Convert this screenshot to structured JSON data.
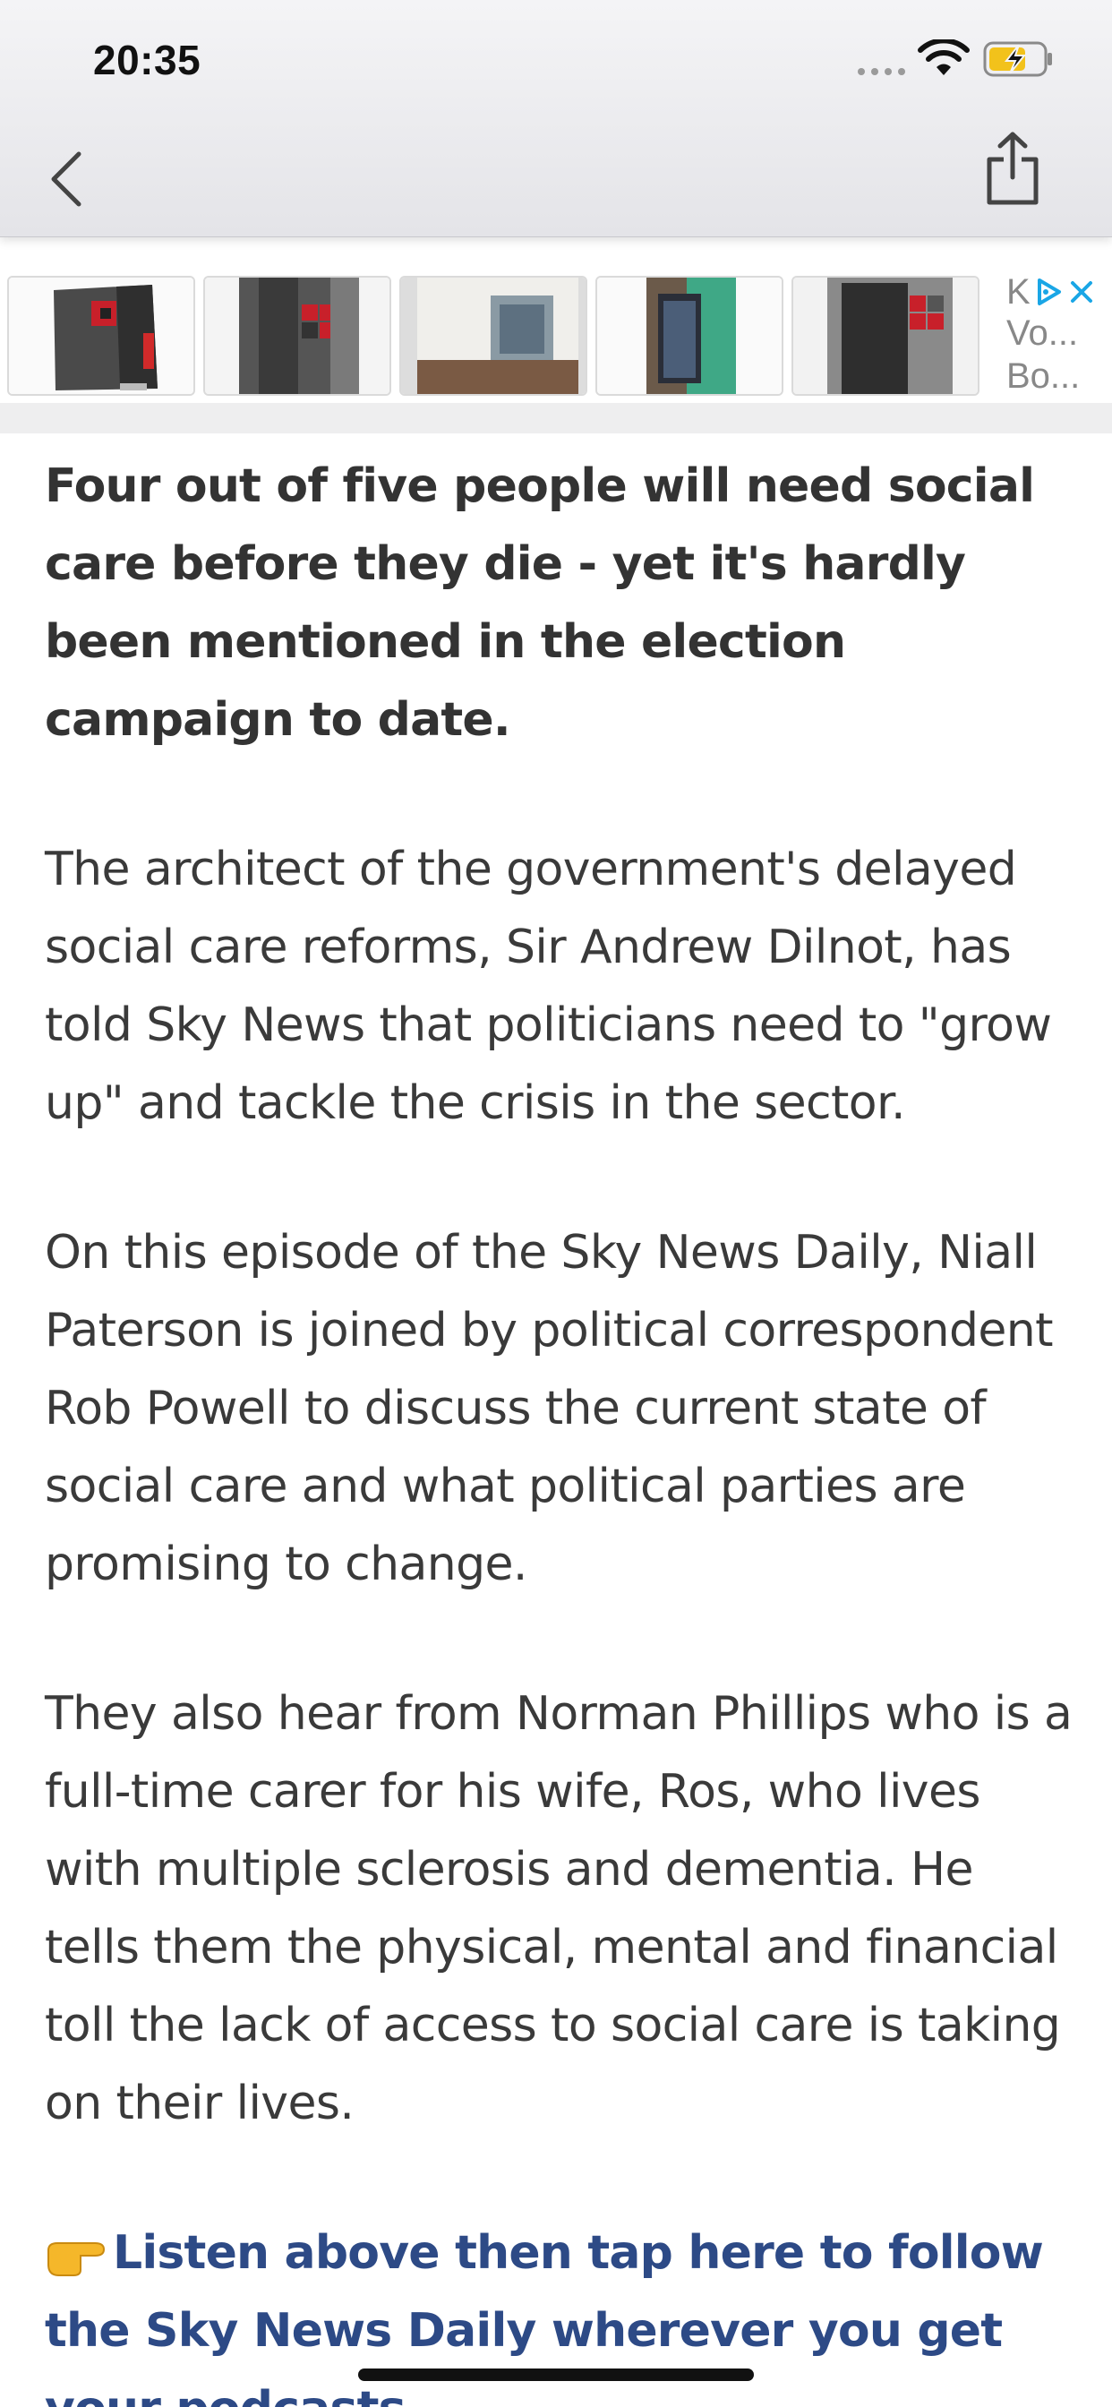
{
  "status_bar": {
    "time": "20:35"
  },
  "nav": {
    "back_icon": "chevron-left-icon",
    "share_icon": "share-icon"
  },
  "ad": {
    "side_line1": "Vo...",
    "side_line2": "Bo...",
    "brand_letter": "K",
    "colors": {
      "adchoices": "#1aa6e6"
    }
  },
  "article": {
    "lead": "Four out of five people will need social care before they die - yet it's hardly been mentioned in the election campaign to date.",
    "paragraphs": [
      "The architect of the government's delayed social care reforms, Sir Andrew Dilnot, has told Sky News that politicians need to \"grow up\" and tackle the crisis in the sector.",
      "On this episode of the Sky News Daily, Niall Paterson is joined by political correspondent Rob Powell to discuss the current state of social care and what political parties are promising to change.",
      "They also hear from Norman Phillips who is a full-time carer for his wife, Ros, who lives with multiple sclerosis and dementia. He tells them the physical, mental and financial toll the lack of access to social care is taking on their lives."
    ],
    "cta": "Listen above then tap here to follow the Sky News Daily wherever you get your podcasts",
    "colors": {
      "link": "#2d4a86",
      "text": "#3a3a3a"
    }
  }
}
